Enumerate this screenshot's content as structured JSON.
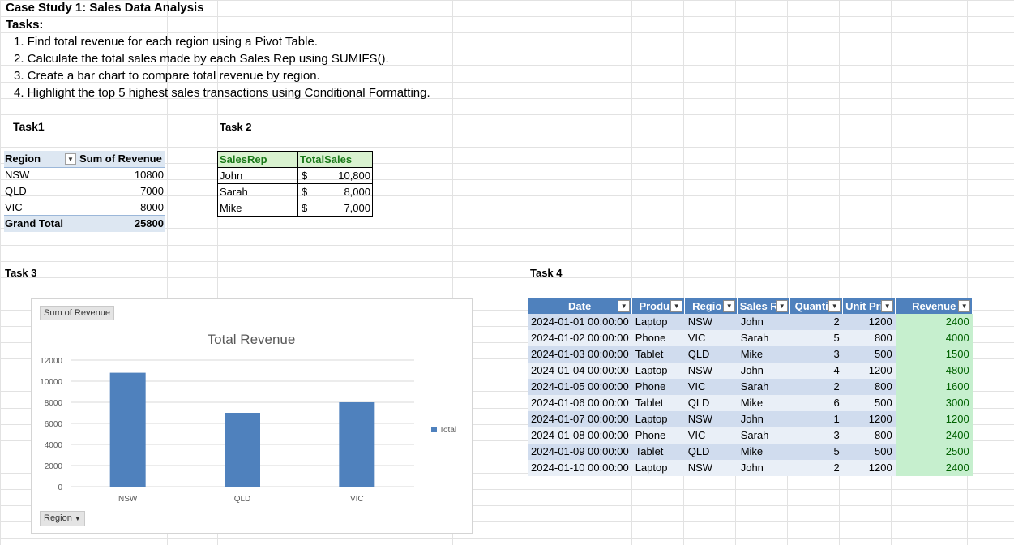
{
  "case_title": "Case Study 1: Sales Data Analysis",
  "tasks_heading": "Tasks:",
  "tasks": [
    "1. Find total revenue for each region using a Pivot Table.",
    "2. Calculate the total sales made by each Sales Rep using SUMIFS().",
    "3. Create a bar chart to compare total revenue by region.",
    "4. Highlight the top 5 highest sales transactions using Conditional Formatting."
  ],
  "task1": {
    "label": "Task1",
    "headers": [
      "Region",
      "Sum of Revenue"
    ],
    "rows": [
      {
        "region": "NSW",
        "value": "10800"
      },
      {
        "region": "QLD",
        "value": "7000"
      },
      {
        "region": "VIC",
        "value": "8000"
      }
    ],
    "total_label": "Grand Total",
    "total_value": "25800"
  },
  "task2": {
    "label": "Task 2",
    "headers": [
      "SalesRep",
      "TotalSales"
    ],
    "rows": [
      {
        "rep": "John",
        "cur": "$",
        "amount": "10,800"
      },
      {
        "rep": "Sarah",
        "cur": "$",
        "amount": "8,000"
      },
      {
        "rep": "Mike",
        "cur": "$",
        "amount": "7,000"
      }
    ]
  },
  "task3": {
    "label": "Task 3",
    "value_chip": "Sum of Revenue",
    "axis_chip": "Region",
    "chart_data": {
      "type": "bar",
      "title": "Total Revenue",
      "categories": [
        "NSW",
        "QLD",
        "VIC"
      ],
      "series": [
        {
          "name": "Total",
          "values": [
            10800,
            7000,
            8000
          ]
        }
      ],
      "ylim": [
        0,
        12000
      ],
      "yticks": [
        "0",
        "2000",
        "4000",
        "6000",
        "8000",
        "10000",
        "12000"
      ],
      "grid": true,
      "legend": "right",
      "bar_color": "#4f81bd"
    }
  },
  "task4": {
    "label": "Task 4",
    "headers": [
      "Date",
      "Produ",
      "Regio",
      "Sales R",
      "Quanti",
      "Unit Pri",
      "Revenue"
    ],
    "rows": [
      [
        "2024-01-01 00:00:00",
        "Laptop",
        "NSW",
        "John",
        "2",
        "1200",
        "2400"
      ],
      [
        "2024-01-02 00:00:00",
        "Phone",
        "VIC",
        "Sarah",
        "5",
        "800",
        "4000"
      ],
      [
        "2024-01-03 00:00:00",
        "Tablet",
        "QLD",
        "Mike",
        "3",
        "500",
        "1500"
      ],
      [
        "2024-01-04 00:00:00",
        "Laptop",
        "NSW",
        "John",
        "4",
        "1200",
        "4800"
      ],
      [
        "2024-01-05 00:00:00",
        "Phone",
        "VIC",
        "Sarah",
        "2",
        "800",
        "1600"
      ],
      [
        "2024-01-06 00:00:00",
        "Tablet",
        "QLD",
        "Mike",
        "6",
        "500",
        "3000"
      ],
      [
        "2024-01-07 00:00:00",
        "Laptop",
        "NSW",
        "John",
        "1",
        "1200",
        "1200"
      ],
      [
        "2024-01-08 00:00:00",
        "Phone",
        "VIC",
        "Sarah",
        "3",
        "800",
        "2400"
      ],
      [
        "2024-01-09 00:00:00",
        "Tablet",
        "QLD",
        "Mike",
        "5",
        "500",
        "2500"
      ],
      [
        "2024-01-10 00:00:00",
        "Laptop",
        "NSW",
        "John",
        "2",
        "1200",
        "2400"
      ]
    ],
    "highlight_color": "#c6efce",
    "header_color": "#4f81bd"
  }
}
